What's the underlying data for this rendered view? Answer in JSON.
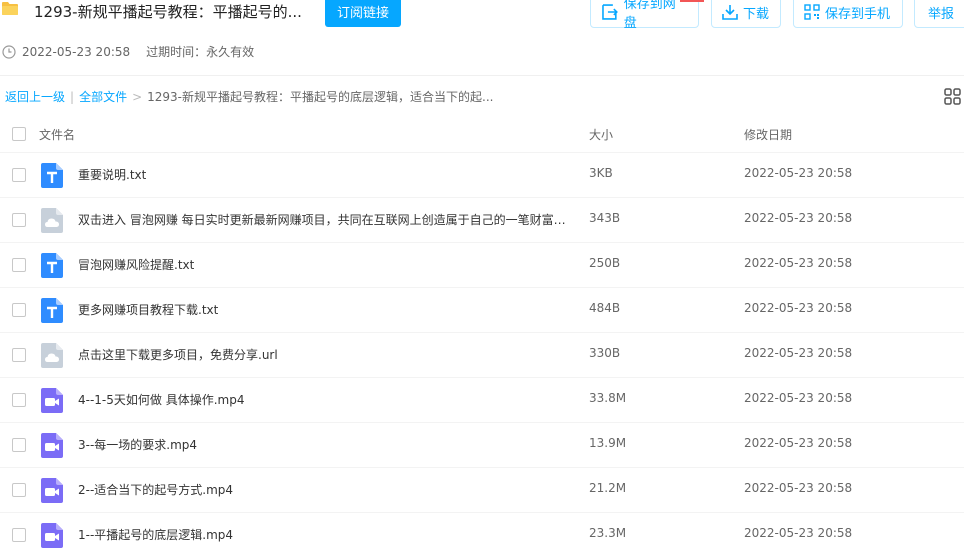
{
  "header": {
    "title": "1293-新规平播起号教程：平播起号的...",
    "subscribe_label": "订阅链接",
    "save_to_disk_label": "保存到网盘",
    "download_label": "下载",
    "save_to_phone_label": "保存到手机",
    "report_label": "举报"
  },
  "meta": {
    "timestamp": "2022-05-23 20:58",
    "expire_text": "过期时间：永久有效"
  },
  "breadcrumb": {
    "back": "返回上一级",
    "divider": "|",
    "all_files": "全部文件",
    "arrow": ">",
    "current": "1293-新规平播起号教程：平播起号的底层逻辑，适合当下的起..."
  },
  "columns": {
    "name": "文件名",
    "size": "大小",
    "date": "修改日期"
  },
  "colors": {
    "accent": "#06a7ff",
    "doc_icon": "#2f8cff",
    "link_icon": "#c7d0da",
    "video_icon": "#7b6cf6",
    "folder": "#f7c042"
  },
  "files": [
    {
      "name": "重要说明.txt",
      "size": "3KB",
      "date": "2022-05-23 20:58",
      "icon": "text-file-icon"
    },
    {
      "name": "双击进入 冒泡网赚 每日实时更新最新网赚项目，共同在互联网上创造属于自己的一笔财富....",
      "size": "343B",
      "date": "2022-05-23 20:58",
      "icon": "link-file-icon"
    },
    {
      "name": "冒泡网赚风险提醒.txt",
      "size": "250B",
      "date": "2022-05-23 20:58",
      "icon": "text-file-icon"
    },
    {
      "name": "更多网赚项目教程下载.txt",
      "size": "484B",
      "date": "2022-05-23 20:58",
      "icon": "text-file-icon"
    },
    {
      "name": "点击这里下载更多项目，免费分享.url",
      "size": "330B",
      "date": "2022-05-23 20:58",
      "icon": "link-file-icon"
    },
    {
      "name": "4--1-5天如何做 具体操作.mp4",
      "size": "33.8M",
      "date": "2022-05-23 20:58",
      "icon": "video-file-icon"
    },
    {
      "name": "3--每一场的要求.mp4",
      "size": "13.9M",
      "date": "2022-05-23 20:58",
      "icon": "video-file-icon"
    },
    {
      "name": "2--适合当下的起号方式.mp4",
      "size": "21.2M",
      "date": "2022-05-23 20:58",
      "icon": "video-file-icon"
    },
    {
      "name": "1--平播起号的底层逻辑.mp4",
      "size": "23.3M",
      "date": "2022-05-23 20:58",
      "icon": "video-file-icon"
    }
  ]
}
